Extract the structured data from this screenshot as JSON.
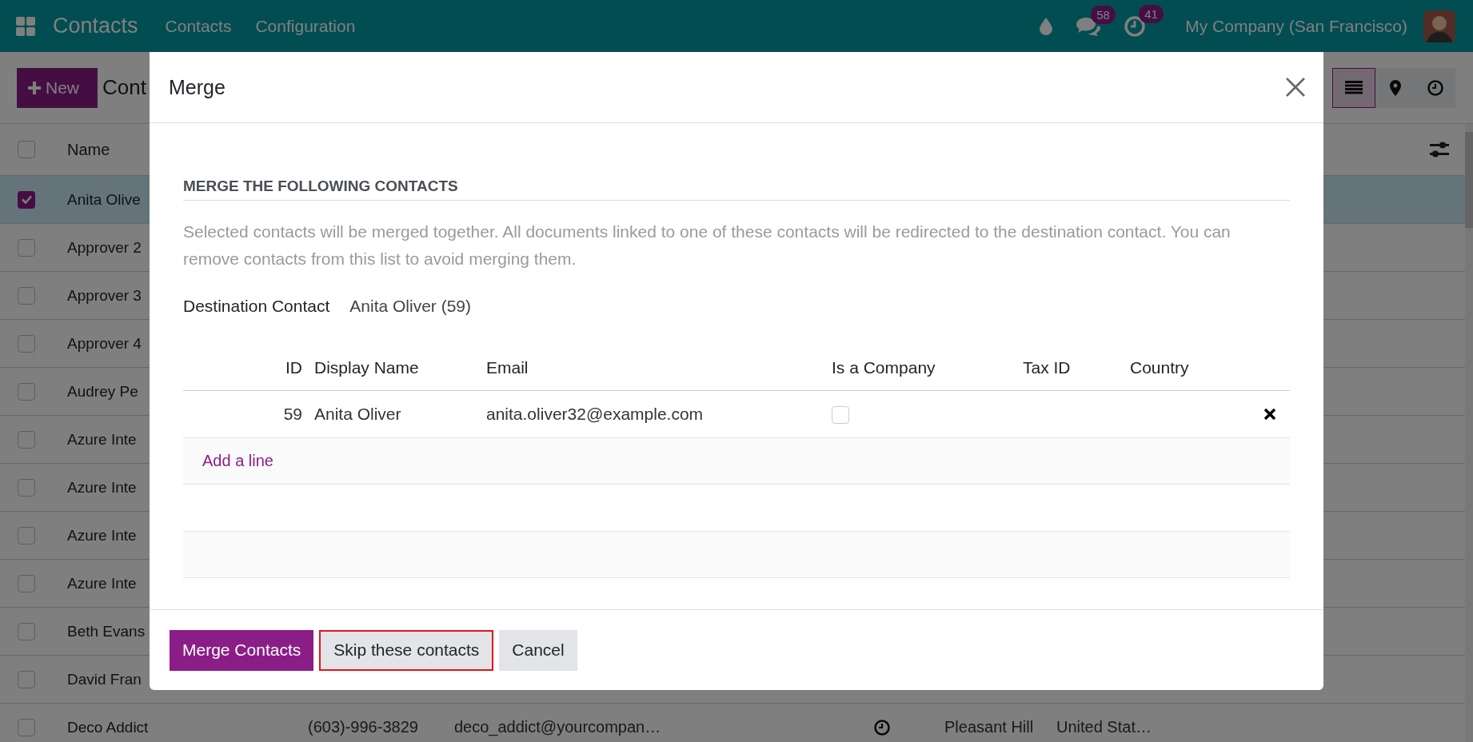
{
  "topbar": {
    "app_name": "Contacts",
    "menu": [
      "Contacts",
      "Configuration"
    ],
    "messages_count": "58",
    "activities_count": "41",
    "company": "My Company (San Francisco)"
  },
  "control_panel": {
    "new_button": "New",
    "breadcrumb": "Cont",
    "views": [
      {
        "kind": "list",
        "selected": true
      },
      {
        "kind": "map",
        "selected": false
      },
      {
        "kind": "activity",
        "selected": false
      }
    ]
  },
  "list": {
    "header": {
      "checked": false,
      "name": "Name"
    },
    "rows": [
      {
        "name": "Anita Olive",
        "checked": true
      },
      {
        "name": "Approver 2",
        "checked": false
      },
      {
        "name": "Approver 3",
        "checked": false
      },
      {
        "name": "Approver 4",
        "checked": false
      },
      {
        "name": "Audrey Pe",
        "checked": false
      },
      {
        "name": "Azure Inte",
        "checked": false
      },
      {
        "name": "Azure Inte",
        "checked": false
      },
      {
        "name": "Azure Inte",
        "checked": false
      },
      {
        "name": "Azure Inte",
        "checked": false
      },
      {
        "name": "Beth Evans",
        "checked": false
      },
      {
        "name": "David Fran",
        "checked": false
      },
      {
        "name": "Deco Addict",
        "checked": false,
        "phone": "(603)-996-3829",
        "email": "deco_addict@yourcompan…",
        "has_activity": true,
        "city": "Pleasant Hill",
        "country": "United Stat…"
      }
    ]
  },
  "dialog": {
    "title": "Merge",
    "section_title": "MERGE THE FOLLOWING CONTACTS",
    "description": "Selected contacts will be merged together. All documents linked to one of these contacts will be redirected to the destination contact. You can remove contacts from this list to avoid merging them.",
    "destination_label": "Destination Contact",
    "destination_value": "Anita Oliver (59)",
    "columns": [
      "ID",
      "Display Name",
      "Email",
      "Is a Company",
      "Tax ID",
      "Country"
    ],
    "rows": [
      {
        "id": "59",
        "display_name": "Anita Oliver",
        "email": "anita.oliver32@example.com",
        "is_company": false
      }
    ],
    "add_line": "Add a line",
    "buttons": [
      {
        "label": "Merge Contacts",
        "kind": "primary",
        "highlighted": false
      },
      {
        "label": "Skip these contacts",
        "kind": "secondary",
        "highlighted": true
      },
      {
        "label": "Cancel",
        "kind": "secondary",
        "highlighted": false
      }
    ]
  }
}
